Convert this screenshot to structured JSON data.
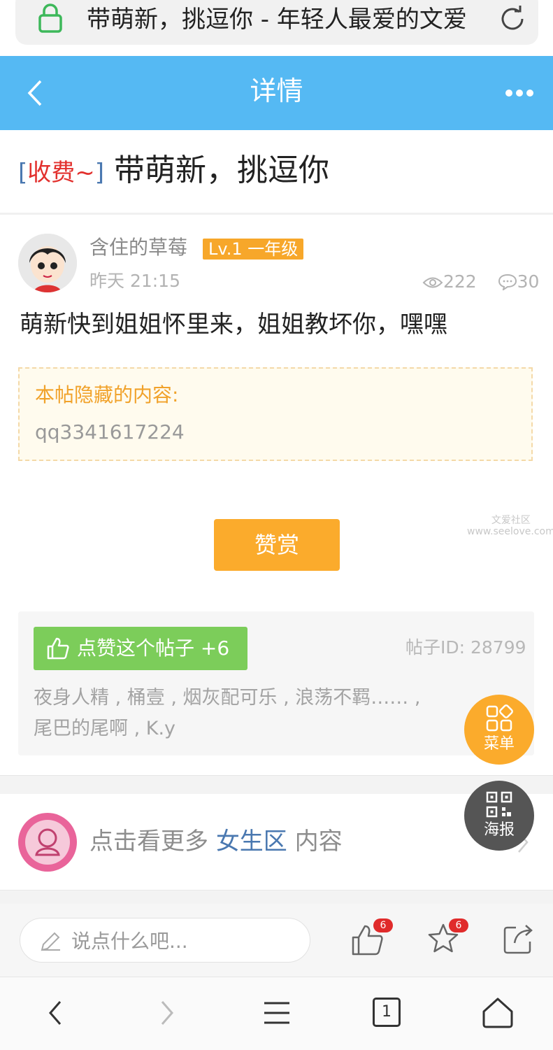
{
  "browser": {
    "url_title": "带萌新，挑逗你 - 年轻人最爱的文爱"
  },
  "header": {
    "title": "详情"
  },
  "post": {
    "tag_open": "[",
    "tag": "收费~",
    "tag_close": "]",
    "title": "带萌新，挑逗你",
    "author": "含住的草莓",
    "level": "Lv.1 一年级",
    "time": "昨天 21:15",
    "views": "222",
    "comments": "30",
    "content": "萌新快到姐姐怀里来，姐姐教坏你，嘿嘿",
    "hidden_label": "本帖隐藏的内容:",
    "hidden_value": "qq3341617224",
    "reward_label": "赞赏",
    "watermark_line1": "文爱社区",
    "watermark_line2": "www.seelove.com"
  },
  "likes": {
    "button_label": "点赞这个帖子 +6",
    "post_id": "帖子ID: 28799",
    "likers_line1": "夜身人精 , 桶壹 , 烟灰配可乐 , 浪荡不羁…… ,",
    "likers_line2": "尾巴的尾啊 , K.y"
  },
  "forum": {
    "prefix": "点击看更多 ",
    "name": "女生区",
    "suffix": " 内容"
  },
  "reply": {
    "placeholder": "说点什么吧...",
    "like_count": "6",
    "fav_count": "6"
  },
  "fab": {
    "menu_label": "菜单",
    "poster_label": "海报"
  },
  "nav": {
    "tab_count": "1"
  },
  "colors": {
    "header_blue": "#55b9f3",
    "accent_orange": "#fbab2c",
    "like_green": "#7ccd5a",
    "tag_red": "#e2302d",
    "link_blue": "#4a78b0"
  }
}
